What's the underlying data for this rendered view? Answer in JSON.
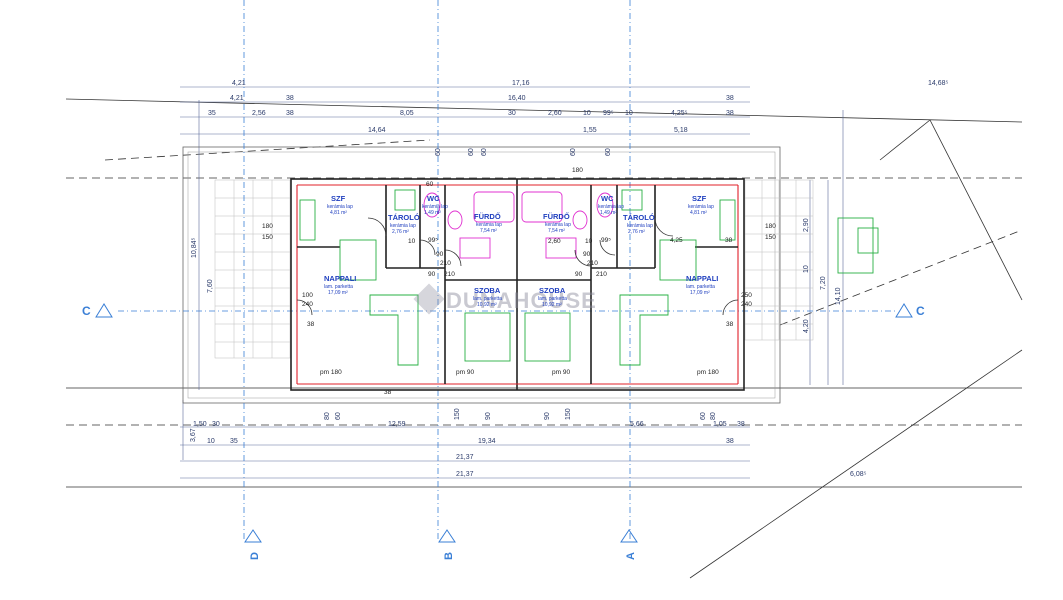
{
  "dims_top": {
    "overall": "17,16",
    "right_a": "14,68⁵",
    "left_a": "4,21",
    "left_b": "4,21",
    "thick_a": "38",
    "total_b": "16,40",
    "thick_b": "38",
    "r1_35": "35",
    "r1_256": "2,56",
    "r1_38": "38",
    "r1_805": "8,05",
    "r1_30": "30",
    "r1_260": "2,60",
    "r1_10a": "10",
    "r1_99": "99⁵",
    "r1_10b": "10",
    "r1_425": "4,25⁵",
    "r1_38b": "38",
    "r2_1464": "14,64",
    "r2_155": "1,55",
    "r2_518": "5,18",
    "w60a": "60",
    "w60b": "60",
    "w60c": "60",
    "w60d": "60",
    "w60e": "60"
  },
  "dims_bottom": {
    "d150a": "1,50",
    "d30": "30",
    "d1259": "12,59",
    "d566": "5,66",
    "d105": "1,05",
    "d38": "38",
    "d367": "3,67",
    "d10a": "10",
    "d35": "35",
    "d1934": "19,34",
    "d38b": "38",
    "d2137a": "21,37",
    "d2137b": "21,37",
    "d608": "6,08⁵",
    "w80a": "80",
    "w60a": "60",
    "w150a": "150",
    "w90a": "90",
    "w150b": "150",
    "w90b": "90",
    "w60b": "60",
    "w80b": "80"
  },
  "dims_left": {
    "d1084": "10,84⁵",
    "d760": "7,60"
  },
  "dims_right": {
    "d290": "2,90",
    "d10": "10",
    "d720": "7,20",
    "d1410": "14,10",
    "d420": "4,20"
  },
  "rooms": {
    "szf_l": {
      "name": "SZF",
      "sub": "kerámia lap",
      "area": "4,81 m²"
    },
    "wc_l": {
      "name": "WC",
      "sub": "kerámia lap",
      "area": "1,49 m²"
    },
    "tarolo_l": {
      "name": "TÁROLÓ",
      "sub": "kerámia lap",
      "area": "2,76 m²"
    },
    "furdo_l": {
      "name": "FÜRDŐ",
      "sub": "kerámia lap",
      "area": "7,54 m²"
    },
    "furdo_r": {
      "name": "FÜRDŐ",
      "sub": "kerámia lap",
      "area": "7,54 m²"
    },
    "wc_r": {
      "name": "WC",
      "sub": "kerámia lap",
      "area": "1,49 m²"
    },
    "tarolo_r": {
      "name": "TÁROLÓ",
      "sub": "kerámia lap",
      "area": "2,76 m²"
    },
    "szf_r": {
      "name": "SZF",
      "sub": "kerámia lap",
      "area": "4,81 m²"
    },
    "nappali_l": {
      "name": "NAPPALI",
      "sub": "lam. parketta",
      "area": "17,09 m²"
    },
    "nappali_r": {
      "name": "NAPPALI",
      "sub": "lam. parketta",
      "area": "17,09 m²"
    },
    "szoba_l": {
      "name": "SZOBA",
      "sub": "lam. parketta",
      "area": "10,92 m²"
    },
    "szoba_r": {
      "name": "SZOBA",
      "sub": "lam. parketta",
      "area": "10,92 m²"
    }
  },
  "interior_labels": {
    "i180l": "180",
    "i150l": "150",
    "i10l": "10",
    "i99l": "99⁵",
    "i90l": "90",
    "i210l": "210",
    "i180r": "180",
    "i150r": "150",
    "i10r": "10",
    "i99r": "99⁵",
    "i90r": "90",
    "i210r": "210",
    "i260": "2,60",
    "i425": "4,25",
    "i38": "38",
    "i60l": "60",
    "i180s": "180",
    "i100": "100",
    "i240": "240",
    "i250": "250",
    "i240r": "240",
    "i38l": "38",
    "i38r": "38",
    "i90sl": "90",
    "i210sl": "210",
    "i90sr": "90",
    "i210sr": "210",
    "i38b": "38",
    "pm1": "pm 180",
    "pm2": "pm 90",
    "pm3": "pm 90",
    "pm4": "pm 180"
  },
  "axes": {
    "c_left": "C",
    "c_right": "C",
    "d": "D",
    "b": "B",
    "a": "A"
  },
  "watermark": "DUNAHOUSE",
  "colors": {
    "axis": "#3a7fd6",
    "wall_red": "#e0202a",
    "furniture_green": "#27b043",
    "sanitary_magenta": "#e030d0",
    "room_text": "#1f3fbf"
  }
}
